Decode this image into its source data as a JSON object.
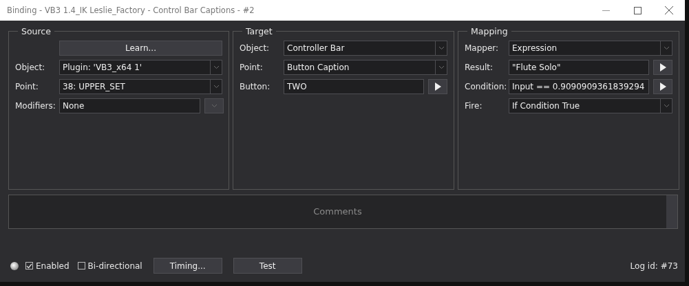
{
  "window": {
    "title": "Binding - VB3 1.4_IK Leslie_Factory - Control Bar Captions - #2"
  },
  "groups": [
    {
      "title": "Source",
      "button": "Learn...",
      "rows": [
        {
          "label": "Object:",
          "value": "Plugin: 'VB3_x64 1'",
          "kind": "dropdown"
        },
        {
          "label": "Point:",
          "value": "38: UPPER_SET",
          "kind": "dropdown"
        },
        {
          "label": "Modifiers:",
          "value": "None",
          "kind": "combo"
        }
      ]
    },
    {
      "title": "Target",
      "rows": [
        {
          "label": "Object:",
          "value": "Controller Bar",
          "kind": "dropdown"
        },
        {
          "label": "Point:",
          "value": "Button Caption",
          "kind": "dropdown"
        },
        {
          "label": "Button:",
          "value": "TWO",
          "kind": "run"
        }
      ]
    },
    {
      "title": "Mapping",
      "rows": [
        {
          "label": "Mapper:",
          "value": "Expression",
          "kind": "dropdown"
        },
        {
          "label": "Result:",
          "value": "\"Flute Solo\"",
          "kind": "run"
        },
        {
          "label": "Condition:",
          "value": "Input == 0.9090909361839294",
          "kind": "run"
        },
        {
          "label": "Fire:",
          "value": "If Condition True",
          "kind": "dropdown"
        }
      ]
    }
  ],
  "comments": {
    "placeholder": "Comments"
  },
  "footer": {
    "checks": [
      {
        "label": "Enabled",
        "checked": true
      },
      {
        "label": "Bi-directional",
        "checked": false
      }
    ],
    "buttons": [
      "Timing...",
      "Test"
    ],
    "log_id": "Log id: #73"
  }
}
